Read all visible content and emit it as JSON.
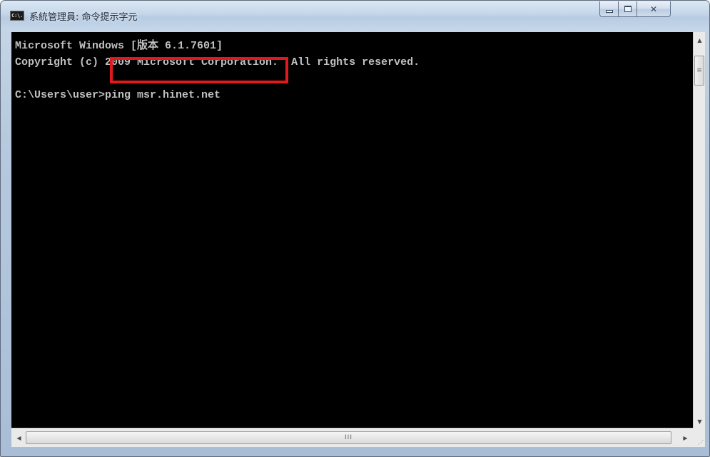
{
  "window": {
    "title": "系統管理員: 命令提示字元",
    "icon_text": "C:\\.",
    "icon_name": "cmd-app-icon",
    "controls": {
      "minimize_icon": "minimize-icon",
      "maximize_icon": "maximize-icon",
      "close_icon": "close-icon",
      "close_glyph": "☒"
    }
  },
  "console": {
    "lines": [
      "Microsoft Windows [版本 6.1.7601]",
      "Copyright (c) 2009 Microsoft Corporation.  All rights reserved.",
      "",
      "C:\\Users\\user>ping msr.hinet.net"
    ],
    "background_color": "#000000",
    "text_color": "#c0c0c0",
    "highlight_color": "#e0191e"
  },
  "scrollbars": {
    "up_arrow": "▲",
    "down_arrow": "▼",
    "left_arrow": "◀",
    "right_arrow": "▶",
    "vertical_grip": "≡",
    "horizontal_grip": "III",
    "resize_grip": "⋰"
  }
}
